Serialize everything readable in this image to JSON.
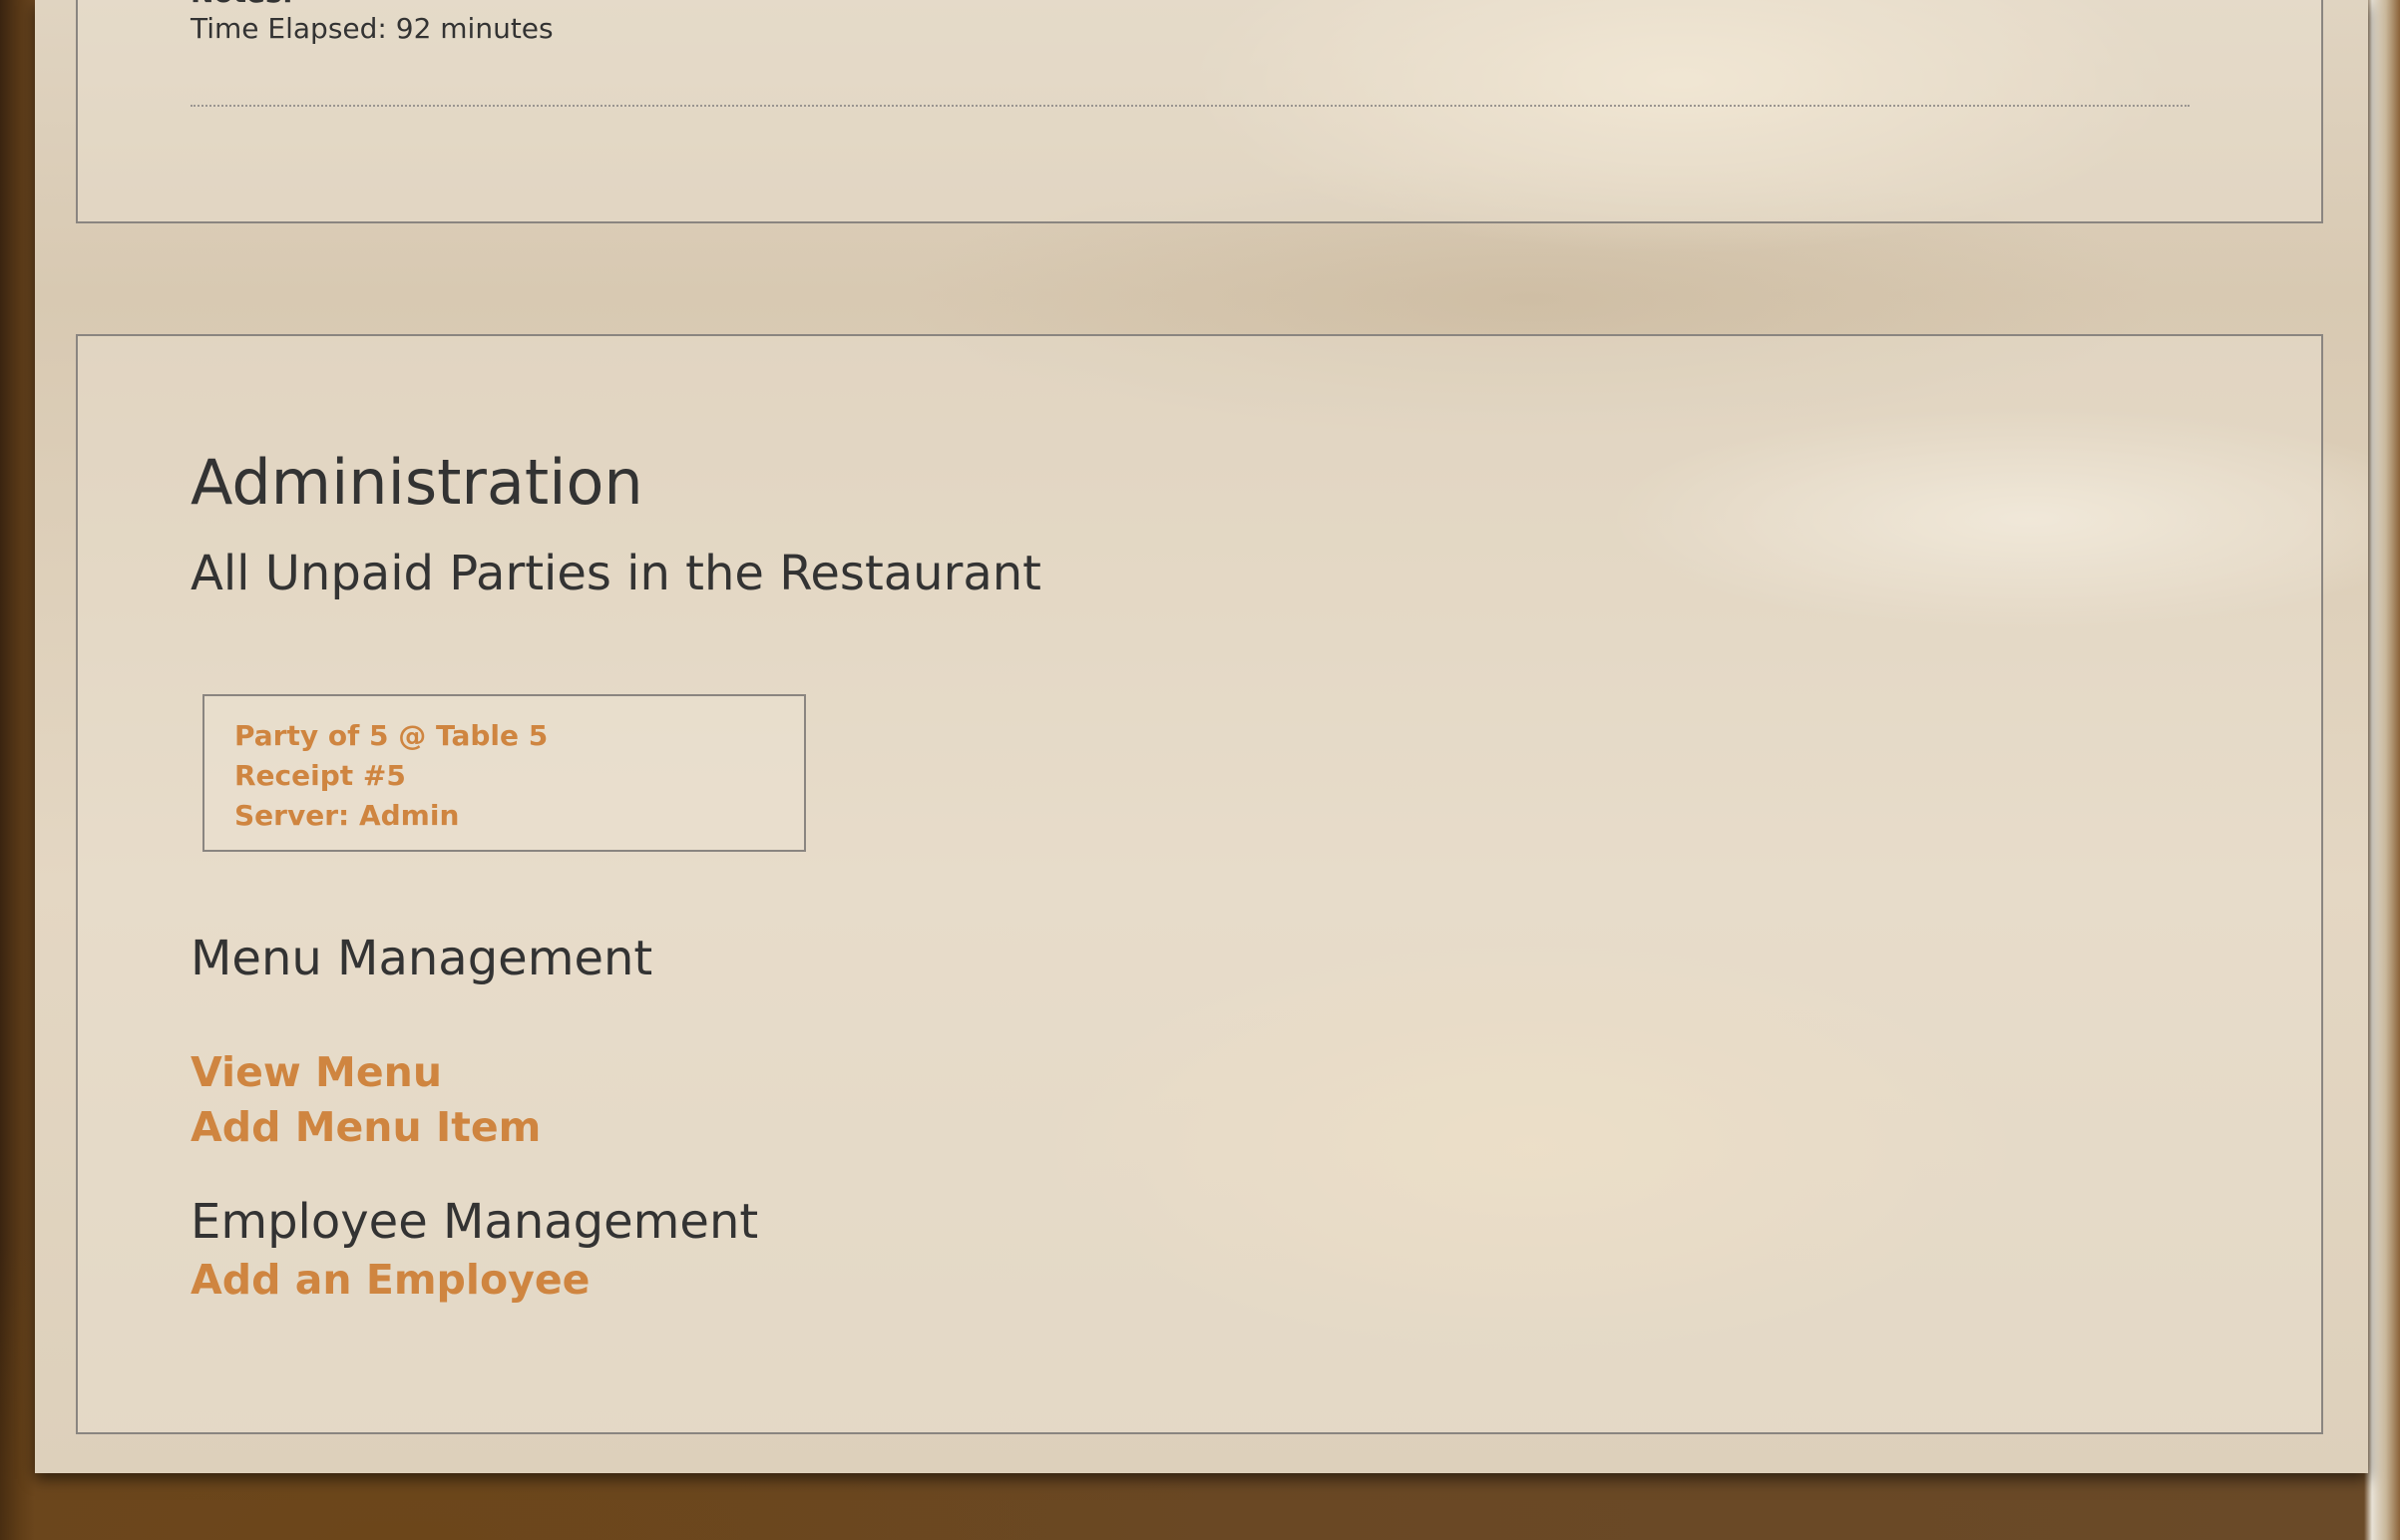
{
  "top_section": {
    "notes_label": "Notes:",
    "time_elapsed": "Time Elapsed: 92 minutes"
  },
  "admin": {
    "title": "Administration",
    "unpaid_title": "All Unpaid Parties in the Restaurant",
    "parties": [
      {
        "line1": "Party of 5 @ Table 5",
        "line2": "Receipt #5",
        "line3": "Server: Admin"
      }
    ],
    "menu_management": {
      "title": "Menu Management",
      "view_menu": "View Menu",
      "add_menu_item": "Add Menu Item"
    },
    "employee_management": {
      "title": "Employee Management",
      "add_employee": "Add an Employee"
    }
  },
  "colors": {
    "link": "#cf8540",
    "text": "#333333",
    "border": "#8a8580"
  }
}
